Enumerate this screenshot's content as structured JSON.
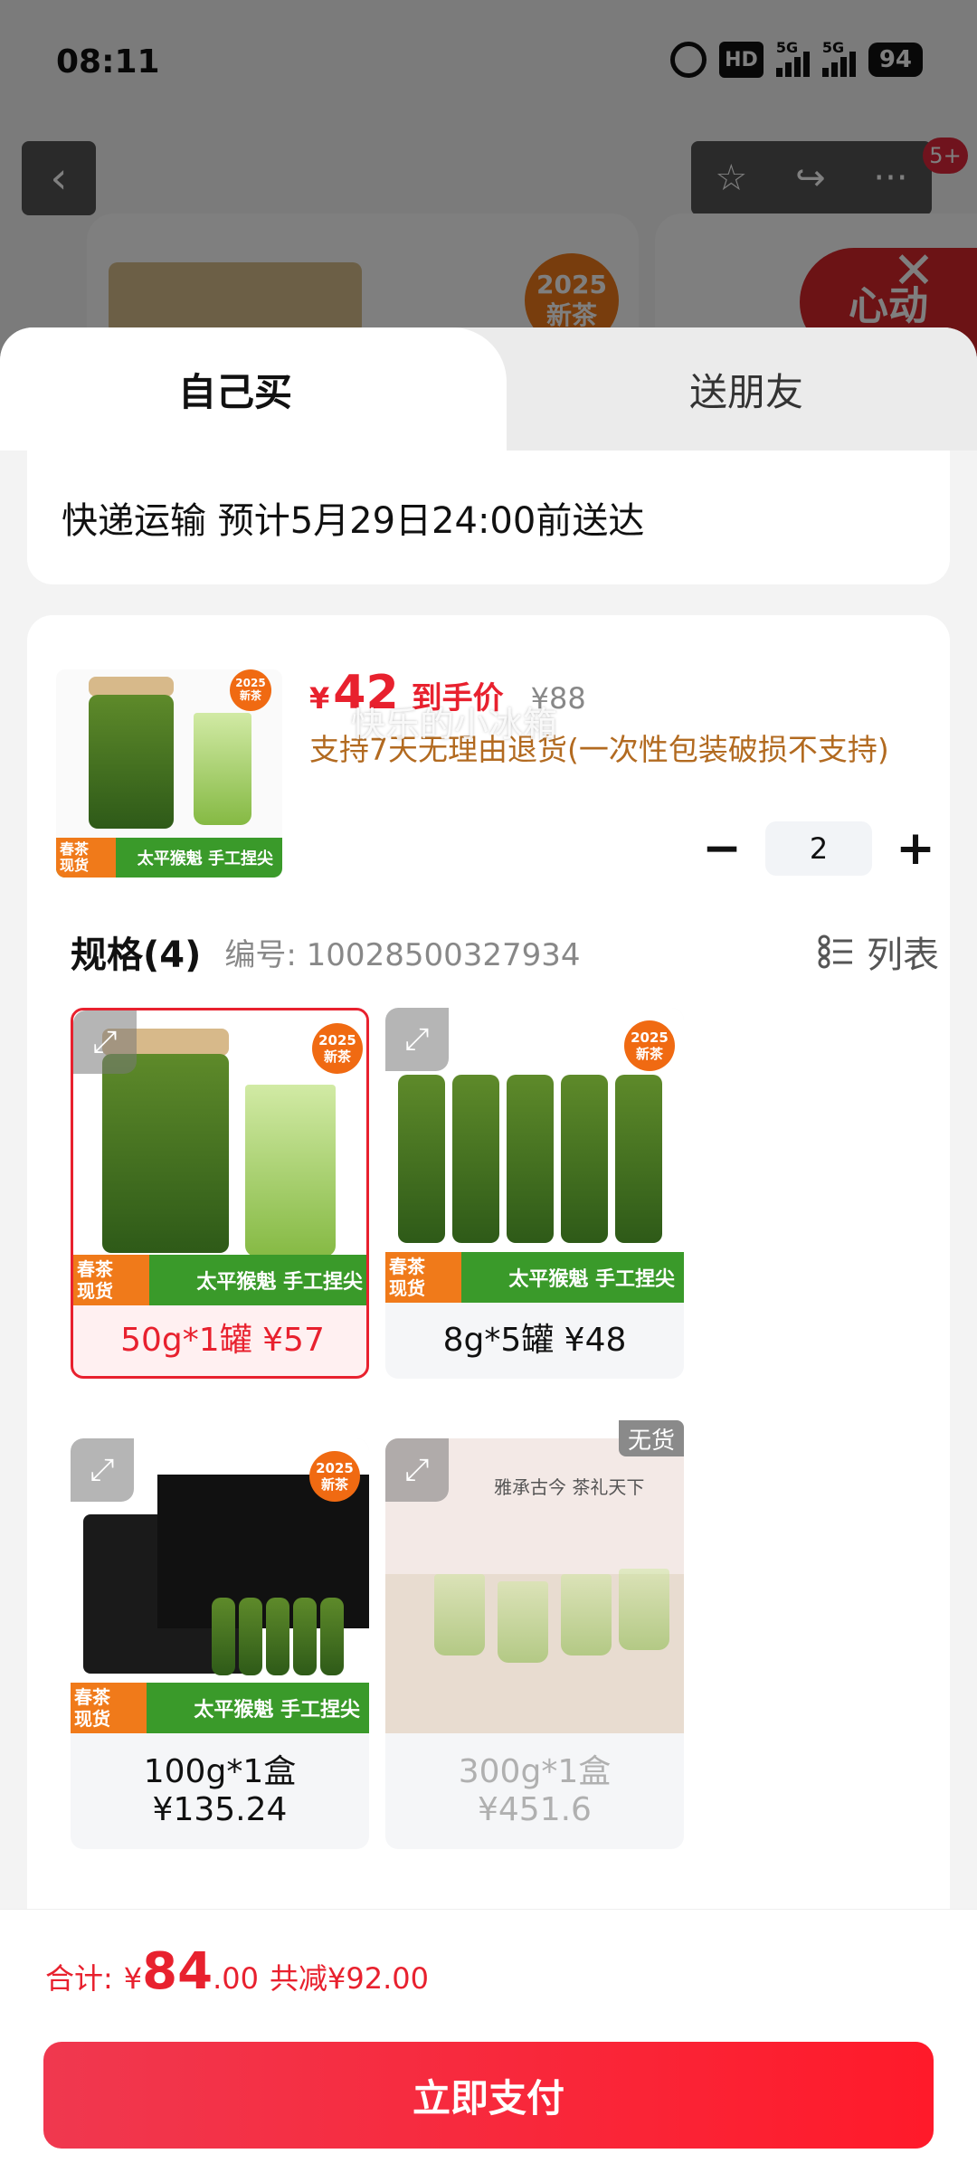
{
  "status_bar": {
    "time": "08:11",
    "hd": "HD",
    "sig1": "5G",
    "sig2": "5G",
    "battery": "94"
  },
  "background": {
    "badge_count": "5+",
    "new_tag": "2025\n新茶",
    "promo": "心动"
  },
  "tabs": {
    "self_buy": "自己买",
    "gift": "送朋友"
  },
  "shipping": {
    "text": "快递运输 预计5月29日24:00前送达"
  },
  "product": {
    "price_currency": "¥",
    "price": "42",
    "price_label": "到手价",
    "original_price": "¥88",
    "return_policy": "支持7天无理由退货(一次性包装破损不支持)",
    "quantity": "2",
    "thumb_new": "2025\n新茶",
    "thumb_banner": "太平猴魁 手工捏尖",
    "thumb_banner_left": "春茶\n现货"
  },
  "specs": {
    "title": "规格(4)",
    "code": "编号: 10028500327934",
    "list_toggle": "列表",
    "watermark": "快乐的小冰箱",
    "options": [
      {
        "label": "50g*1罐 ¥57",
        "selected": true,
        "available": true,
        "new": "2025\n新茶",
        "banner": "太平猴魁 手工捏尖",
        "banner_left": "春茶\n现货"
      },
      {
        "label": "8g*5罐 ¥48",
        "selected": false,
        "available": true,
        "new": "2025\n新茶",
        "banner": "太平猴魁 手工捏尖",
        "banner_left": "春茶\n现货"
      },
      {
        "label": "100g*1盒\n¥135.24",
        "selected": false,
        "available": true,
        "new": "2025\n新茶",
        "banner": "太平猴魁 手工捏尖",
        "banner_left": "春茶\n现货"
      },
      {
        "label": "300g*1盒\n¥451.6",
        "selected": false,
        "available": false,
        "stock_tag": "无货",
        "caption": "雅承古今 茶礼天下"
      }
    ]
  },
  "footer": {
    "total_label": "合计:",
    "total_currency": "¥",
    "total_int": "84",
    "total_dec": ".00",
    "total_save": "共减¥92.00",
    "pay_button": "立即支付"
  },
  "colors": {
    "accent": "#e8212e",
    "return_text": "#b26a20",
    "tea_green": "#3a9a2a",
    "badge_orange": "#f06a12"
  }
}
